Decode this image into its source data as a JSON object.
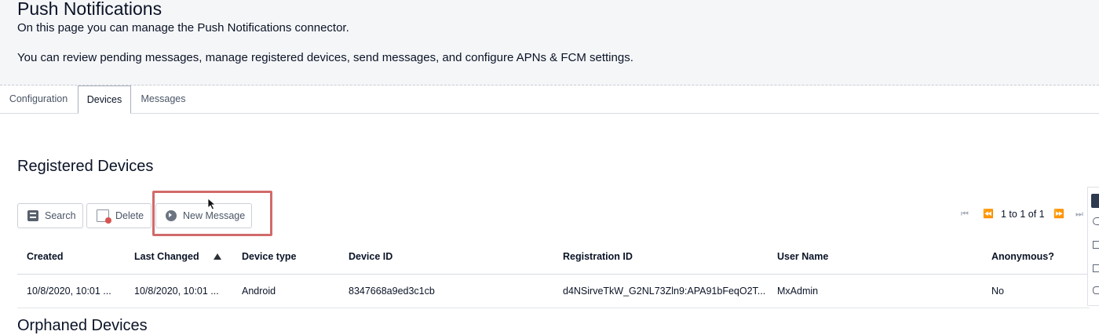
{
  "header": {
    "title": "Push Notifications",
    "description_line1": "On this page you can manage the Push Notifications connector.",
    "description_line2": "You can review pending messages, manage registered devices, send messages, and configure APNs & FCM settings."
  },
  "tabs": [
    {
      "label": "Configuration",
      "active": false
    },
    {
      "label": "Devices",
      "active": true
    },
    {
      "label": "Messages",
      "active": false
    }
  ],
  "section": {
    "title": "Registered Devices",
    "next_section_title": "Orphaned Devices"
  },
  "toolbar": {
    "search_label": "Search",
    "delete_label": "Delete",
    "new_message_label": "New Message"
  },
  "pager": {
    "text": "1 to 1 of 1"
  },
  "table": {
    "columns": [
      "Created",
      "Last Changed",
      "Device type",
      "Device ID",
      "Registration ID",
      "User Name",
      "Anonymous?"
    ],
    "sorted_column": "Last Changed",
    "sort_direction": "ascending",
    "rows": [
      {
        "created": "10/8/2020, 10:01 ...",
        "last_changed": "10/8/2020, 10:01 ...",
        "device_type": "Android",
        "device_id": "8347668a9ed3c1cb",
        "registration_id": "d4NSirveTkW_G2NL73Zln9:APA91bFeqO2T...",
        "user_name": "MxAdmin",
        "anonymous": "No"
      }
    ]
  },
  "colors": {
    "header_bg": "#f5f6f8",
    "highlight_box": "#d26a6a",
    "text": "#0a1326"
  }
}
